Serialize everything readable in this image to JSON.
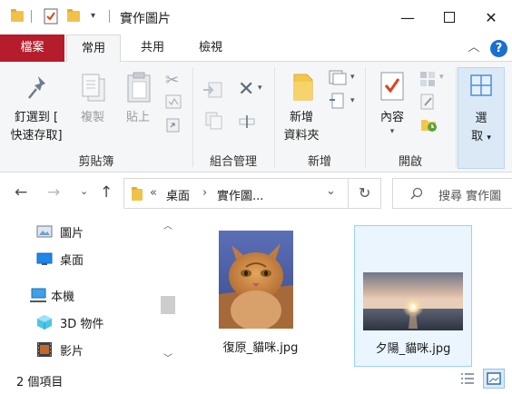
{
  "window": {
    "title": "實作圖片",
    "min_glyph": "—",
    "max_glyph": "☐",
    "close_glyph": "✕"
  },
  "ribbon_tabs": {
    "file": "檔案",
    "home": "常用",
    "share": "共用",
    "view": "檢視",
    "collapse_glyph": "︿",
    "help_glyph": "?"
  },
  "ribbon": {
    "clipboard": {
      "pin_label_1": "釘選到 [",
      "pin_label_2": "快速存取]",
      "copy_label": "複製",
      "paste_label": "貼上",
      "group": "剪貼簿"
    },
    "organize": {
      "group": "組合管理"
    },
    "new": {
      "folder_label_1": "新增",
      "folder_label_2": "資料夾",
      "group": "新增"
    },
    "open": {
      "properties_label": "內容",
      "group": "開啟"
    },
    "select": {
      "label_1": "選",
      "label_2": "取"
    }
  },
  "address": {
    "chevrons": "«",
    "crumb_1": "桌面",
    "sep": "›",
    "crumb_2": "實作圖...",
    "dropdown": "⌄",
    "refresh": "↻"
  },
  "search": {
    "placeholder": "搜尋 實作圖"
  },
  "nav_pane": {
    "items": [
      {
        "label": "圖片",
        "icon": "pictures-icon"
      },
      {
        "label": "桌面",
        "icon": "desktop-icon"
      },
      {
        "label": "本機",
        "icon": "this-pc-icon"
      },
      {
        "label": "3D 物件",
        "icon": "3d-objects-icon"
      },
      {
        "label": "影片",
        "icon": "videos-icon"
      }
    ]
  },
  "files": [
    {
      "name": "復原_貓咪.jpg",
      "selected": false
    },
    {
      "name": "夕陽_貓咪.jpg",
      "selected": true
    }
  ],
  "status": {
    "count": "2 個項目"
  },
  "colors": {
    "file_tab": "#b51c2c",
    "accent": "#1a6fd1",
    "selection_border": "#99d1ff",
    "selection_fill": "#eaf5fe"
  }
}
